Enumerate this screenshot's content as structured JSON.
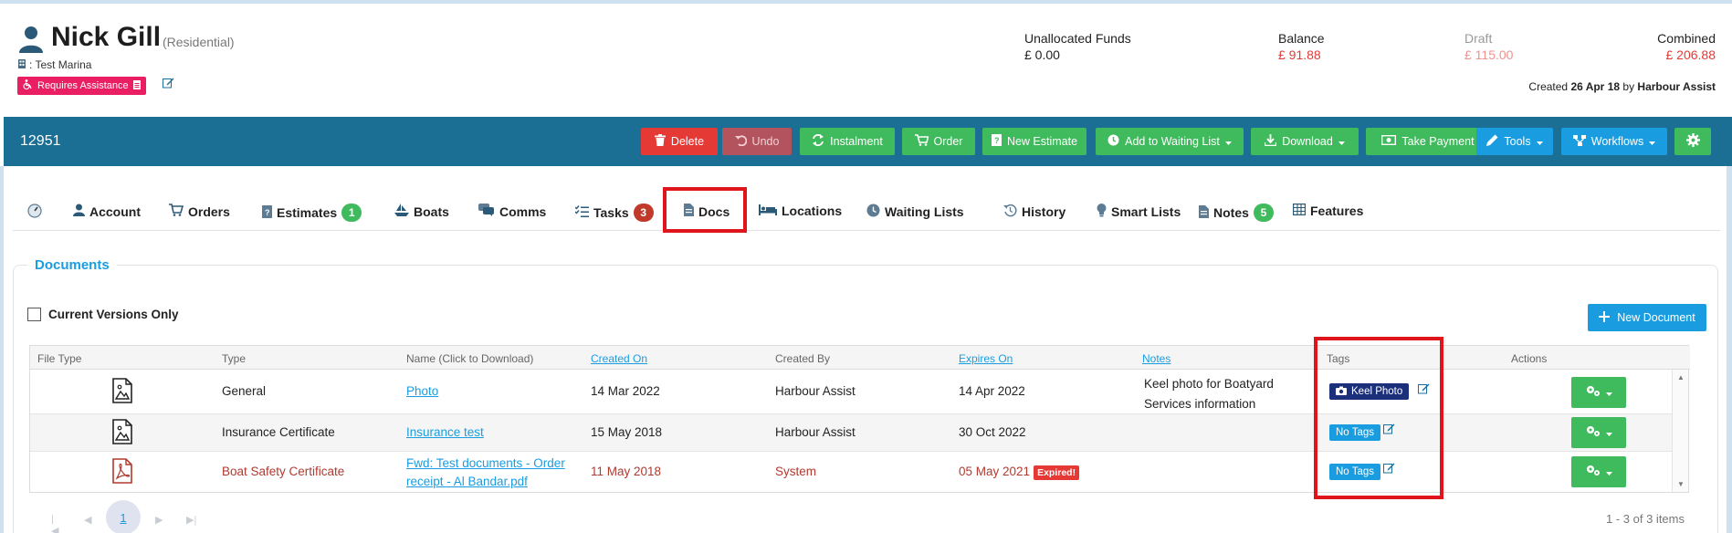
{
  "customer": {
    "name": "Nick Gill",
    "type": "(Residential)",
    "marina": ": Test Marina",
    "assistance_badge": "Requires Assistance"
  },
  "funds": {
    "unallocated_label": "Unallocated Funds",
    "unallocated_value": "£ 0.00",
    "balance_label": "Balance",
    "balance_value": "£ 91.88",
    "draft_label": "Draft",
    "draft_value": "£ 115.00",
    "combined_label": "Combined",
    "combined_value": "£ 206.88"
  },
  "created": {
    "prefix": "Created",
    "date": "26 Apr 18",
    "by": "by",
    "user": "Harbour Assist"
  },
  "toolbar": {
    "account_number": "12951",
    "delete": "Delete",
    "undo": "Undo",
    "instalment": "Instalment",
    "order": "Order",
    "new_estimate": "New Estimate",
    "waiting_list": "Add to Waiting List",
    "download": "Download",
    "take_payment": "Take Payment",
    "tools": "Tools",
    "workflows": "Workflows"
  },
  "tabs": {
    "account": "Account",
    "orders": "Orders",
    "estimates": "Estimates",
    "estimates_count": "1",
    "boats": "Boats",
    "comms": "Comms",
    "tasks": "Tasks",
    "tasks_count": "3",
    "docs": "Docs",
    "locations": "Locations",
    "waiting_lists": "Waiting Lists",
    "history": "History",
    "smart_lists": "Smart Lists",
    "notes": "Notes",
    "notes_count": "5",
    "features": "Features"
  },
  "documents": {
    "legend": "Documents",
    "current_versions_only": "Current Versions Only",
    "new_document": "New Document",
    "columns": {
      "file_type": "File Type",
      "type": "Type",
      "name": "Name (Click to Download)",
      "created_on": "Created On",
      "created_by": "Created By",
      "expires_on": "Expires On",
      "notes": "Notes",
      "tags": "Tags",
      "actions": "Actions"
    },
    "rows": [
      {
        "file_icon": "image-file-icon",
        "type": "General",
        "name": "Photo",
        "created_on": "14 Mar 2022",
        "created_by": "Harbour Assist",
        "expires_on": "14 Apr 2022",
        "notes_line1": "Keel photo for Boatyard",
        "notes_line2": "Services information",
        "tag": "Keel Photo"
      },
      {
        "file_icon": "image-file-icon",
        "type": "Insurance Certificate",
        "name": "Insurance test",
        "created_on": "15 May 2018",
        "created_by": "Harbour Assist",
        "expires_on": "30 Oct 2022",
        "tag": "No Tags"
      },
      {
        "file_icon": "pdf-file-icon",
        "type": "Boat Safety Certificate",
        "name_line1": "Fwd: Test documents - Order",
        "name_line2": "receipt - Al Bandar.pdf",
        "created_on": "11 May 2018",
        "created_by": "System",
        "expires_on": "05 May 2021",
        "expired_badge": "Expired!",
        "tag": "No Tags"
      }
    ]
  },
  "pager": {
    "current_page": "1",
    "items_summary": "1 - 3 of 3 items"
  },
  "colors": {
    "toolbar": "#1b6e94",
    "green": "#3fba5c",
    "blue": "#1a9de0",
    "red": "#e53935",
    "highlight": "#e0141b"
  }
}
